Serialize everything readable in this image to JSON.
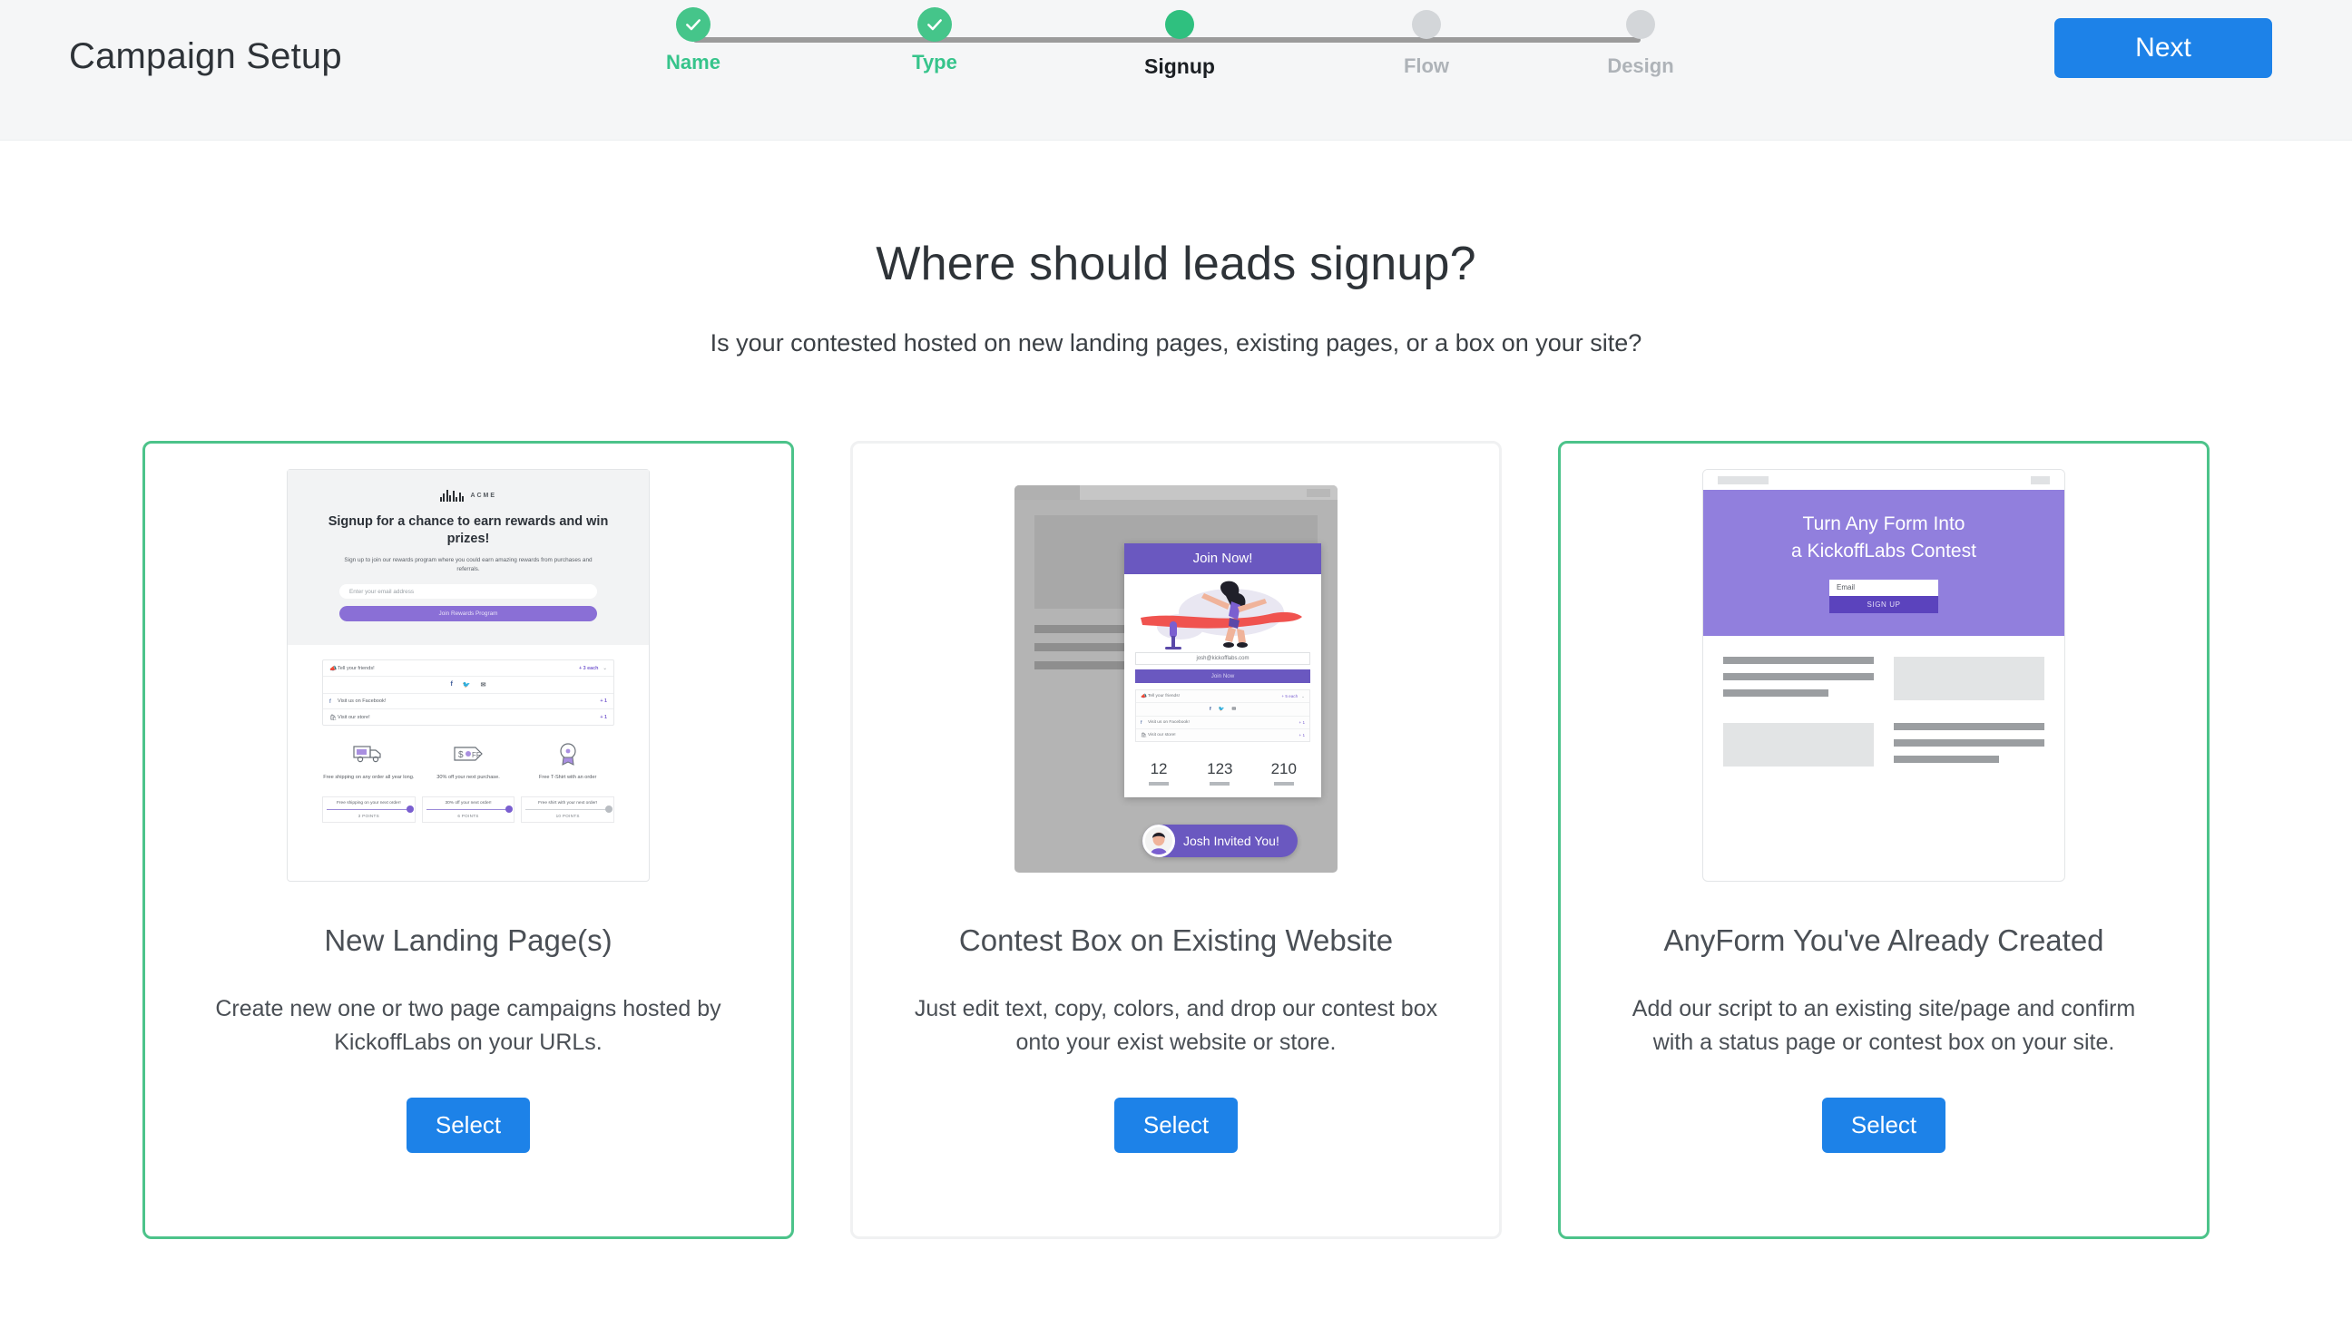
{
  "header": {
    "title": "Campaign Setup",
    "next_label": "Next",
    "steps": [
      {
        "label": "Name",
        "state": "done"
      },
      {
        "label": "Type",
        "state": "done"
      },
      {
        "label": "Signup",
        "state": "current"
      },
      {
        "label": "Flow",
        "state": "todo"
      },
      {
        "label": "Design",
        "state": "todo"
      }
    ]
  },
  "main": {
    "heading": "Where should leads signup?",
    "subheading": "Is your contested hosted on new landing pages, existing pages, or a box on your site?",
    "cards": [
      {
        "title": "New Landing Page(s)",
        "description": "Create new one or two page campaigns hosted by KickoffLabs on your URLs.",
        "select_label": "Select",
        "selected": true
      },
      {
        "title": "Contest Box on Existing Website",
        "description": "Just edit text, copy, colors, and drop our contest box onto your exist website or store.",
        "select_label": "Select",
        "selected": false
      },
      {
        "title": "AnyForm You've Already Created",
        "description": "Add our script to an existing site/page and confirm with a status page or contest box on your site.",
        "select_label": "Select",
        "selected": true
      }
    ]
  },
  "thumb_landing": {
    "logo_text": "ACME",
    "headline": "Signup for a chance to earn rewards and win prizes!",
    "paragraph": "Sign up to join our rewards program where you could earn amazing rewards from purchases and referrals.",
    "email_placeholder": "Enter your email address",
    "cta_label": "Join Rewards Program",
    "share_rows": [
      {
        "label": "Tell your friends!",
        "points": "+ 3 each"
      },
      {
        "label": "Visit us on Facebook!",
        "points": "+ 1"
      },
      {
        "label": "Visit our store!",
        "points": "+ 1"
      }
    ],
    "rewards": [
      {
        "text": "Free shipping on any order all year long.",
        "bar_title": "Free shipping on your next order!",
        "points": "3 POINTS",
        "reached": true
      },
      {
        "text": "30% off your next purchase.",
        "bar_title": "30% off your next order!",
        "points": "6 POINTS",
        "reached": true
      },
      {
        "text": "Free T-Shirt with an order",
        "bar_title": "Free shirt with your next order!",
        "points": "10 POINTS",
        "reached": false
      }
    ]
  },
  "thumb_contestbox": {
    "box_title": "Join Now!",
    "email_value": "josh@kickofflabs.com",
    "join_label": "Join Now",
    "share_rows": [
      {
        "label": "Tell your friends!",
        "points": "+ 5 each"
      },
      {
        "label": "Visit us on Facebook!",
        "points": "+ 1"
      },
      {
        "label": "Visit our store!",
        "points": "+ 1"
      }
    ],
    "stats": [
      "12",
      "123",
      "210"
    ],
    "invite_badge": "Josh Invited You!"
  },
  "thumb_anyform": {
    "headline_line1": "Turn Any Form Into",
    "headline_line2": "a KickoffLabs Contest",
    "email_placeholder": "Email",
    "signup_label": "SIGN UP"
  },
  "colors": {
    "accent_green": "#4cc38a",
    "primary_blue": "#1d82e8",
    "purple": "#6a58c0",
    "header_bg": "#f5f6f7"
  }
}
